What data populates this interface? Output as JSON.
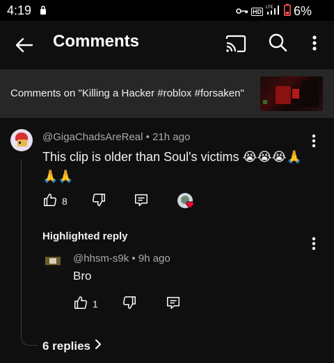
{
  "status_bar": {
    "time": "4:19",
    "battery_percent": "6%",
    "network_badge": "HD",
    "icons": [
      "lock-icon",
      "vpn-key-icon",
      "hd-icon",
      "lte-signal-icon",
      "battery-low-icon"
    ],
    "battery_color": "#ff5252"
  },
  "app_bar": {
    "title": "Comments",
    "icons": [
      "back-arrow-icon",
      "cast-icon",
      "search-icon",
      "more-vert-icon"
    ]
  },
  "video_banner": {
    "text": "Comments on \"Killing a Hacker #roblox #forsaken\""
  },
  "comment": {
    "author": "@GigaChadsAreReal",
    "separator": "•",
    "time": "21h ago",
    "text": "This clip is older than Soul's victims 😭😭😭🙏🙏🙏",
    "like_count": "8",
    "hearted_by_creator": true
  },
  "reply_section": {
    "label": "Highlighted reply",
    "reply": {
      "author": "@hhsm-s9k",
      "separator": "•",
      "time": "9h ago",
      "text": "Bro",
      "like_count": "1"
    },
    "replies_link": "6 replies"
  },
  "colors": {
    "background": "#0f0f0f",
    "banner": "#272727",
    "text_primary": "#f1f1f1",
    "text_secondary": "#aaaaaa",
    "heart": "#ff0033"
  }
}
